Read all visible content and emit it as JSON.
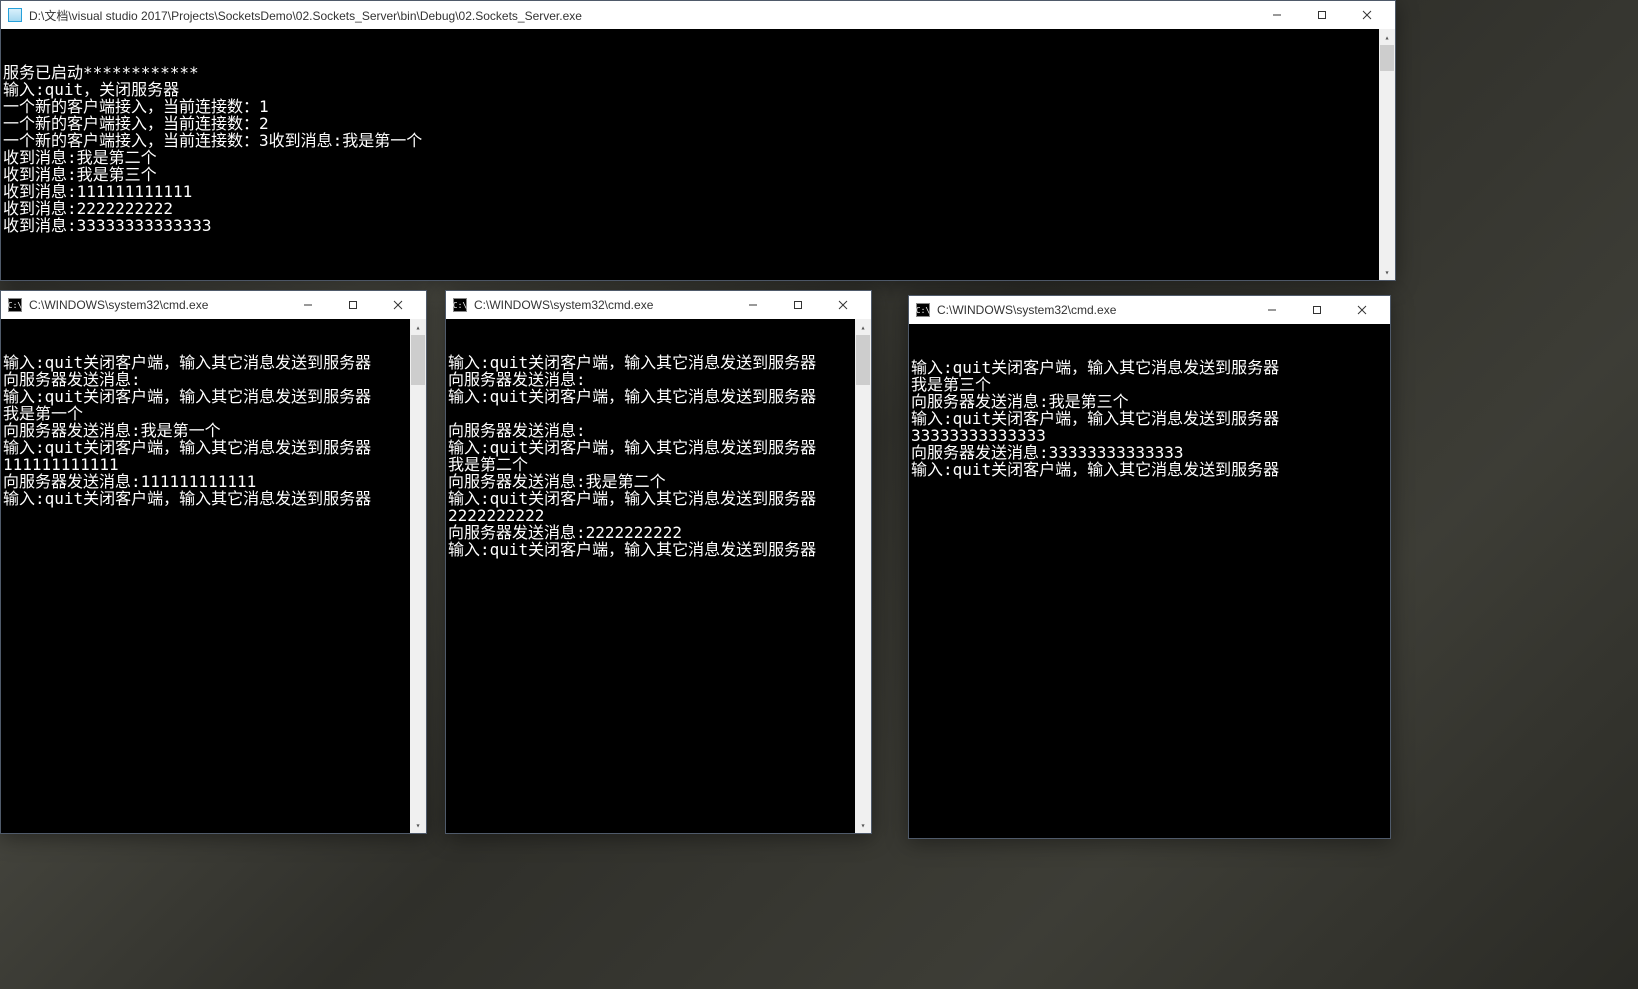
{
  "server": {
    "title": "D:\\文档\\visual studio 2017\\Projects\\SocketsDemo\\02.Sockets_Server\\bin\\Debug\\02.Sockets_Server.exe",
    "lines": [
      "服务已启动************",
      "输入:quit，关闭服务器",
      "一个新的客户端接入，当前连接数：1",
      "一个新的客户端接入，当前连接数：2",
      "一个新的客户端接入，当前连接数：3收到消息:我是第一个",
      "收到消息:我是第二个",
      "收到消息:我是第三个",
      "收到消息:111111111111",
      "收到消息:2222222222",
      "收到消息:33333333333333"
    ]
  },
  "client1": {
    "title": "C:\\WINDOWS\\system32\\cmd.exe",
    "lines": [
      "输入:quit关闭客户端，输入其它消息发送到服务器",
      "向服务器发送消息:",
      "输入:quit关闭客户端，输入其它消息发送到服务器",
      "我是第一个",
      "向服务器发送消息:我是第一个",
      "输入:quit关闭客户端，输入其它消息发送到服务器",
      "111111111111",
      "向服务器发送消息:111111111111",
      "输入:quit关闭客户端，输入其它消息发送到服务器"
    ]
  },
  "client2": {
    "title": "C:\\WINDOWS\\system32\\cmd.exe",
    "lines": [
      "输入:quit关闭客户端，输入其它消息发送到服务器",
      "向服务器发送消息:",
      "输入:quit关闭客户端，输入其它消息发送到服务器",
      "",
      "向服务器发送消息:",
      "输入:quit关闭客户端，输入其它消息发送到服务器",
      "我是第二个",
      "向服务器发送消息:我是第二个",
      "输入:quit关闭客户端，输入其它消息发送到服务器",
      "2222222222",
      "向服务器发送消息:2222222222",
      "输入:quit关闭客户端，输入其它消息发送到服务器"
    ]
  },
  "client3": {
    "title": "C:\\WINDOWS\\system32\\cmd.exe",
    "lines": [
      "输入:quit关闭客户端，输入其它消息发送到服务器",
      "我是第三个",
      "向服务器发送消息:我是第三个",
      "输入:quit关闭客户端，输入其它消息发送到服务器",
      "33333333333333",
      "向服务器发送消息:33333333333333",
      "输入:quit关闭客户端，输入其它消息发送到服务器"
    ]
  },
  "cmd_icon_text": "C:\\",
  "controls": {
    "minimize": "—",
    "maximize": "☐",
    "close": "✕"
  }
}
